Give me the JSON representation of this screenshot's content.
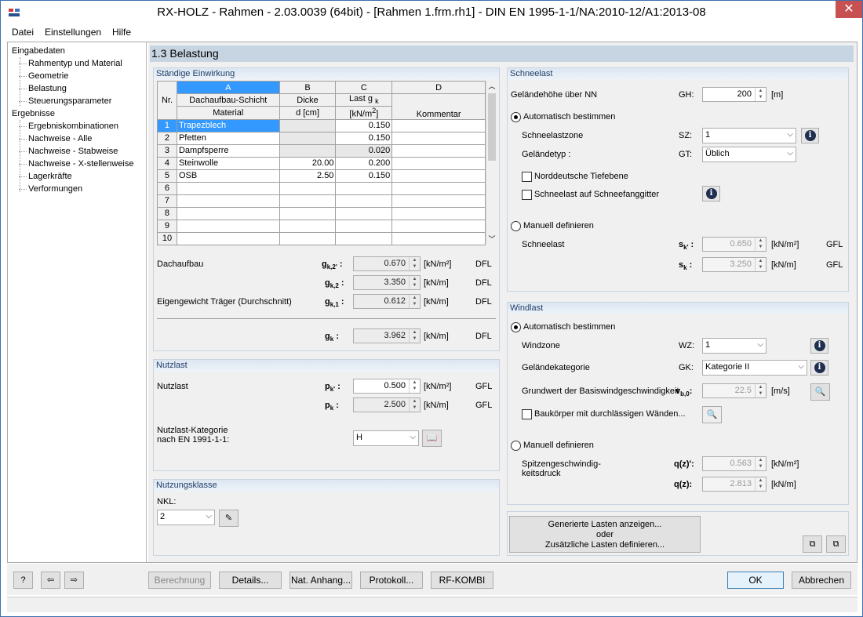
{
  "window": {
    "title": "RX-HOLZ - Rahmen - 2.03.0039 (64bit) - [Rahmen 1.frm.rh1] - DIN EN 1995-1-1/NA:2010-12/A1:2013-08",
    "close": "✕"
  },
  "menu": [
    "Datei",
    "Einstellungen",
    "Hilfe"
  ],
  "nav": {
    "group1": "Eingabedaten",
    "items1": [
      "Rahmentyp und Material",
      "Geometrie",
      "Belastung",
      "Steuerungsparameter"
    ],
    "group2": "Ergebnisse",
    "items2": [
      "Ergebniskombinationen",
      "Nachweise - Alle",
      "Nachweise - Stabweise",
      "Nachweise - X-stellenweise",
      "Lagerkräfte",
      "Verformungen"
    ]
  },
  "header": "1.3 Belastung",
  "staendig": {
    "title": "Ständige Einwirkung",
    "cols": [
      "A",
      "B",
      "C",
      "D"
    ],
    "nr": "Nr.",
    "h_a1": "Dachaufbau-Schicht",
    "h_a2": "Material",
    "h_b1": "Dicke",
    "h_b2": "d [cm]",
    "h_c1": "Last g",
    "h_c1sub": "k",
    "h_c2": "[kN/m",
    "h_c2sup": "2",
    "h_c2end": "]",
    "h_d": "Kommentar",
    "rows": [
      {
        "nr": "1",
        "mat": "Trapezblech",
        "d": "",
        "g": "0.150",
        "k": ""
      },
      {
        "nr": "2",
        "mat": "Pfetten",
        "d": "",
        "g": "0.150",
        "k": ""
      },
      {
        "nr": "3",
        "mat": "Dampfsperre",
        "d": "",
        "g": "0.020",
        "k": ""
      },
      {
        "nr": "4",
        "mat": "Steinwolle",
        "d": "20.00",
        "g": "0.200",
        "k": ""
      },
      {
        "nr": "5",
        "mat": "OSB",
        "d": "2.50",
        "g": "0.150",
        "k": ""
      },
      {
        "nr": "6",
        "mat": "",
        "d": "",
        "g": "",
        "k": ""
      },
      {
        "nr": "7",
        "mat": "",
        "d": "",
        "g": "",
        "k": ""
      },
      {
        "nr": "8",
        "mat": "",
        "d": "",
        "g": "",
        "k": ""
      },
      {
        "nr": "9",
        "mat": "",
        "d": "",
        "g": "",
        "k": ""
      },
      {
        "nr": "10",
        "mat": "",
        "d": "",
        "g": "",
        "k": ""
      }
    ],
    "dachaufbau": "Dachaufbau",
    "eigengewicht": "Eigengewicht Träger (Durchschnitt)",
    "gk2p_sym": "g",
    "gk2p_sub": "k,2'",
    "gk2p_val": "0.670",
    "gk2p_unit": "[kN/m²]",
    "gk2p_tag": "DFL",
    "gk2_sym": "g",
    "gk2_sub": "k,2",
    "gk2_val": "3.350",
    "gk2_unit": "[kN/m]",
    "gk2_tag": "DFL",
    "gk1_sym": "g",
    "gk1_sub": "k,1",
    "gk1_val": "0.612",
    "gk1_unit": "[kN/m]",
    "gk1_tag": "DFL",
    "gk_sym": "g",
    "gk_sub": "k",
    "gk_val": "3.962",
    "gk_unit": "[kN/m]",
    "gk_tag": "DFL"
  },
  "nutzlast": {
    "title": "Nutzlast",
    "label": "Nutzlast",
    "pkp_sym": "p",
    "pkp_sub": "k'",
    "pkp_val": "0.500",
    "pkp_unit": "[kN/m²]",
    "pkp_tag": "GFL",
    "pk_sym": "p",
    "pk_sub": "k",
    "pk_val": "2.500",
    "pk_unit": "[kN/m]",
    "pk_tag": "GFL",
    "kat1": "Nutzlast-Kategorie",
    "kat2": "nach EN 1991-1-1:",
    "kat_val": "H"
  },
  "nkl": {
    "title": "Nutzungsklasse",
    "label": "NKL:",
    "val": "2"
  },
  "schnee": {
    "title": "Schneelast",
    "gh_label": "Geländehöhe über NN",
    "gh_sym": "GH:",
    "gh_val": "200",
    "gh_unit": "[m]",
    "auto": "Automatisch bestimmen",
    "sz_label": "Schneelastzone",
    "sz_sym": "SZ:",
    "sz_val": "1",
    "gt_label": "Geländetyp :",
    "gt_sym": "GT:",
    "gt_val": "Üblich",
    "cb1": "Norddeutsche Tiefebene",
    "cb2": "Schneelast auf Schneefanggitter",
    "manual": "Manuell definieren",
    "sl_label": "Schneelast",
    "skp_sym": "s",
    "skp_sub": "k'",
    "skp_val": "0.650",
    "skp_unit": "[kN/m²]",
    "skp_tag": "GFL",
    "sk_sym": "s",
    "sk_sub": "k",
    "sk_val": "3.250",
    "sk_unit": "[kN/m]",
    "sk_tag": "GFL"
  },
  "wind": {
    "title": "Windlast",
    "auto": "Automatisch bestimmen",
    "wz_label": "Windzone",
    "wz_sym": "WZ:",
    "wz_val": "1",
    "gk_label": "Geländekategorie",
    "gk_sym": "GK:",
    "gk_val": "Kategorie II",
    "vb_label": "Grundwert der Basiswindgeschwindigkeit",
    "vb_sym": "v",
    "vb_sub": "b,0",
    "vb_colon": ":",
    "vb_val": "22.5",
    "vb_unit": "[m/s]",
    "cb": "Baukörper mit durchlässigen Wänden...",
    "manual": "Manuell definieren",
    "sp1": "Spitzengeschwindig-",
    "sp2": "keitsdruck",
    "qp_sym": "q(z)'",
    "qp_colon": ":",
    "qp_val": "0.563",
    "qp_unit": "[kN/m²]",
    "q_sym": "q(z)",
    "q_colon": ":",
    "q_val": "2.813",
    "q_unit": "[kN/m]"
  },
  "gen": {
    "l1": "Generierte Lasten anzeigen...",
    "l2": "oder",
    "l3": "Zusätzliche Lasten definieren..."
  },
  "buttons": {
    "berechnung": "Berechnung",
    "details": "Details...",
    "anhang": "Nat. Anhang...",
    "protokoll": "Protokoll...",
    "rfkombi": "RF-KOMBI",
    "ok": "OK",
    "abbrechen": "Abbrechen"
  }
}
